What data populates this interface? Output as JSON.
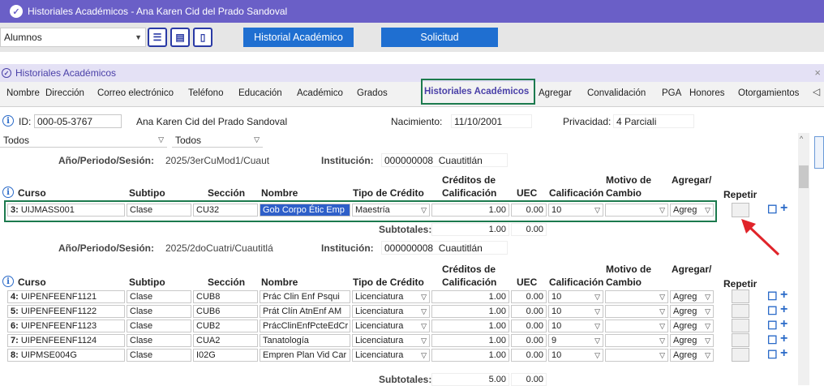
{
  "window": {
    "title": "Historiales Académicos -  Ana Karen Cid del Prado Sandoval"
  },
  "topbar": {
    "module_select": "Alumnos",
    "btn_historial": "Historial Académico",
    "btn_solicitud": "Solicitud"
  },
  "subwindow": {
    "title": "Historiales Académicos"
  },
  "tabs": [
    "Nombre",
    "Dirección",
    "Correo electrónico",
    "Teléfono",
    "Educación",
    "Académico",
    "Grados",
    "Historiales Académicos",
    "Agregar",
    "Convalidación",
    "PGA",
    "Honores",
    "Otorgamientos"
  ],
  "student": {
    "id_label": "ID:",
    "id_value": "000-05-3767",
    "name": "Ana Karen Cid del Prado Sandoval",
    "birth_label": "Nacimiento:",
    "birth_value": "11/10/2001",
    "privacy_label": "Privacidad:",
    "privacy_value": "4 Parciali"
  },
  "filters": {
    "f1": "Todos",
    "f2": "Todos"
  },
  "headers": {
    "curso": "Curso",
    "subtipo": "Subtipo",
    "seccion": "Sección",
    "nombre": "Nombre",
    "tipo": "Tipo de Crédito",
    "creditos1": "Créditos de",
    "creditos2": "Calificación",
    "uec": "UEC",
    "calif": "Calificación",
    "motivo1": "Motivo de",
    "motivo2": "Cambio",
    "agregar": "Agregar/",
    "repetir": "Repetir"
  },
  "period1": {
    "label": "Año/Periodo/Sesión:",
    "value": "2025/3erCuMod1/Cuaut",
    "inst_label": "Institución:",
    "inst_code": "000000008",
    "inst_name": "Cuautitlán"
  },
  "period2": {
    "label": "Año/Periodo/Sesión:",
    "value": "2025/2doCuatri/Cuautitlá",
    "inst_label": "Institución:",
    "inst_code": "000000008",
    "inst_name": "Cuautitlán"
  },
  "rows1": [
    {
      "n": "3:",
      "curso": "UIJMASS001",
      "subtipo": "Clase",
      "seccion": "CU32",
      "nombre": "Gob Corpo Étic Emp",
      "tipo": "Maestría",
      "cred": "1.00",
      "uec": "0.00",
      "calif": "10",
      "agregar": "Agreg"
    }
  ],
  "subtotal1": {
    "label": "Subtotales:",
    "cred": "1.00",
    "uec": "0.00"
  },
  "rows2": [
    {
      "n": "4:",
      "curso": "UIPENFEENF1121",
      "subtipo": "Clase",
      "seccion": "CUB8",
      "nombre": "Prác Clin Enf Psqui",
      "tipo": "Licenciatura",
      "cred": "1.00",
      "uec": "0.00",
      "calif": "10",
      "agregar": "Agreg"
    },
    {
      "n": "5:",
      "curso": "UIPENFEENF1122",
      "subtipo": "Clase",
      "seccion": "CUB6",
      "nombre": "Prát Clín AtnEnf AM",
      "tipo": "Licenciatura",
      "cred": "1.00",
      "uec": "0.00",
      "calif": "10",
      "agregar": "Agreg"
    },
    {
      "n": "6:",
      "curso": "UIPENFEENF1123",
      "subtipo": "Clase",
      "seccion": "CUB2",
      "nombre": "PrácClinEnfPcteEdCr",
      "tipo": "Licenciatura",
      "cred": "1.00",
      "uec": "0.00",
      "calif": "10",
      "agregar": "Agreg"
    },
    {
      "n": "7:",
      "curso": "UIPENFEENF1124",
      "subtipo": "Clase",
      "seccion": "CUA2",
      "nombre": "Tanatología",
      "tipo": "Licenciatura",
      "cred": "1.00",
      "uec": "0.00",
      "calif": "9",
      "agregar": "Agreg"
    },
    {
      "n": "8:",
      "curso": "UIPMSE004G",
      "subtipo": "Clase",
      "seccion": "I02G",
      "nombre": "Empren Plan Vid Car",
      "tipo": "Licenciatura",
      "cred": "1.00",
      "uec": "0.00",
      "calif": "10",
      "agregar": "Agreg"
    }
  ],
  "subtotal2": {
    "label": "Subtotales:",
    "cred": "5.00",
    "uec": "0.00"
  },
  "colors": {
    "titlebar": "#6a5fc7",
    "button": "#1f6fd1",
    "highlight": "#1c7a4e",
    "arrow": "#e0242a"
  }
}
